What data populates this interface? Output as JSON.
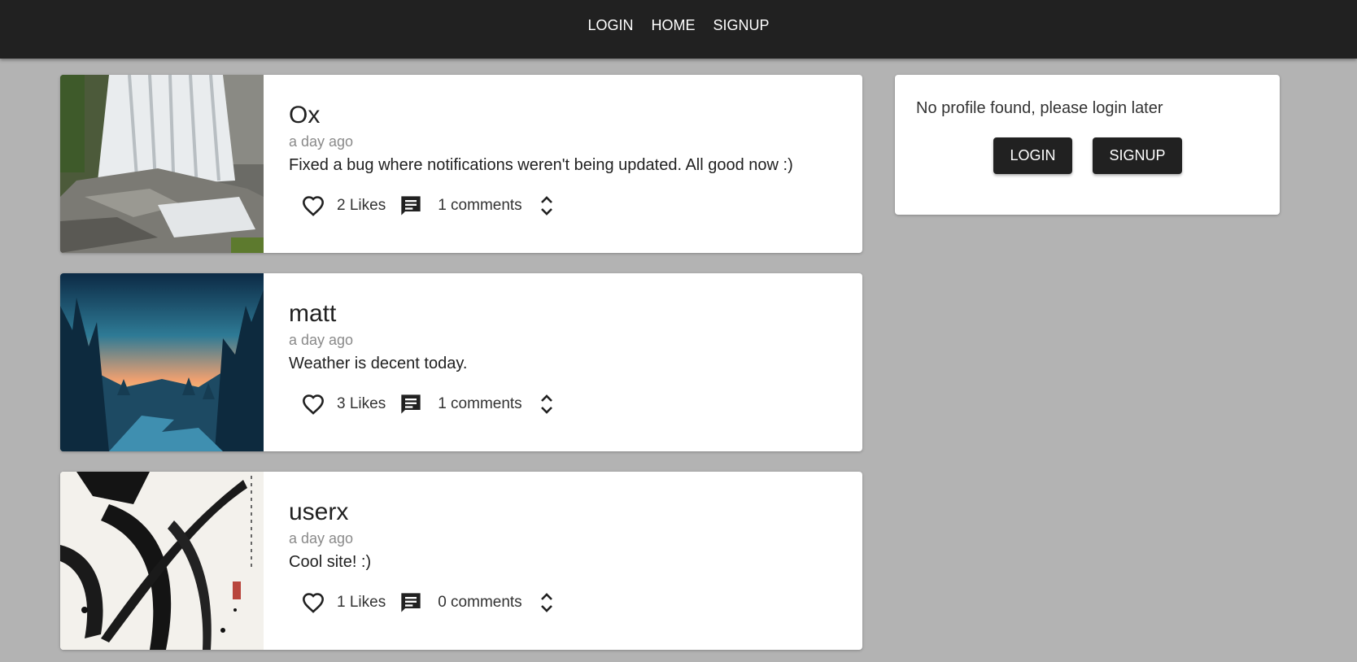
{
  "nav": {
    "login": "LOGIN",
    "home": "HOME",
    "signup": "SIGNUP"
  },
  "posts": [
    {
      "author": "Ox",
      "time": "a day ago",
      "text": "Fixed a bug where notifications weren't being updated. All good now :)",
      "likes": "2 Likes",
      "comments": "1 comments",
      "image": "waterfall"
    },
    {
      "author": "matt",
      "time": "a day ago",
      "text": "Weather is decent today.",
      "likes": "3 Likes",
      "comments": "1 comments",
      "image": "forest-sunset"
    },
    {
      "author": "userx",
      "time": "a day ago",
      "text": "Cool site! :)",
      "likes": "1 Likes",
      "comments": "0 comments",
      "image": "ink-samurai"
    }
  ],
  "profile": {
    "message": "No profile found, please login later",
    "login_label": "LOGIN",
    "signup_label": "SIGNUP"
  },
  "icons": [
    "heart-outline-icon",
    "comment-icon",
    "unfold-icon"
  ],
  "colors": {
    "navbar": "#212121",
    "background": "#b3b3b3",
    "card": "#ffffff",
    "button": "#212121"
  }
}
